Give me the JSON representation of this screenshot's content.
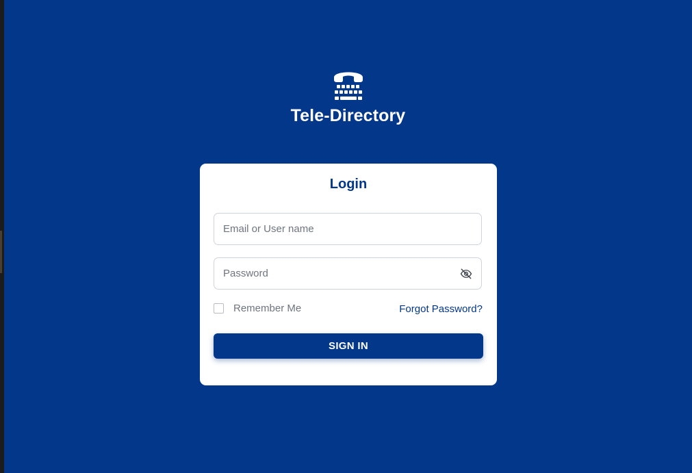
{
  "app": {
    "title": "Tele-Directory",
    "logo_icon": "telephone-keypad-icon"
  },
  "login": {
    "heading": "Login",
    "email_placeholder": "Email or User name",
    "password_placeholder": "Password",
    "password_toggle_icon": "eye-slash-icon",
    "remember_label": "Remember Me",
    "remember_checked": false,
    "forgot_label": "Forgot Password?",
    "submit_label": "SIGN IN"
  },
  "colors": {
    "background": "#03378a",
    "card": "#ffffff",
    "accent": "#03378a",
    "muted_text": "#6e7480"
  }
}
